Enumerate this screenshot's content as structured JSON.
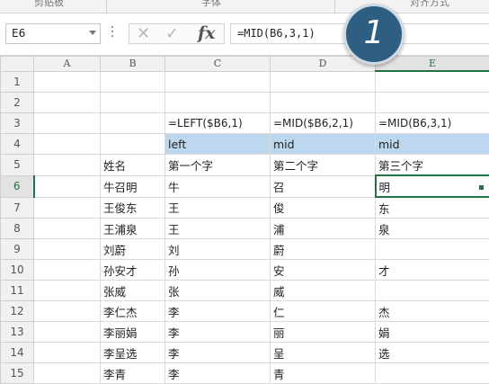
{
  "ribbon": {
    "labels": [
      "剪贴板",
      "字体",
      "对齐方式"
    ]
  },
  "formula_bar": {
    "name_box": "E6",
    "cancel_symbol": "✕",
    "enter_symbol": "✓",
    "fx_symbol": "fx",
    "formula": "=MID(B6,3,1)"
  },
  "step_badge": "1",
  "columns": [
    "A",
    "B",
    "C",
    "D",
    "E"
  ],
  "active_column": "E",
  "active_row": "6",
  "rows": [
    {
      "num": "1",
      "cells": [
        "",
        "",
        "",
        "",
        ""
      ]
    },
    {
      "num": "2",
      "cells": [
        "",
        "",
        "",
        "",
        ""
      ]
    },
    {
      "num": "3",
      "cells": [
        "",
        "",
        "=LEFT($B6,1)",
        "=MID($B6,2,1)",
        "=MID(B6,3,1)"
      ]
    },
    {
      "num": "4",
      "cells": [
        "",
        "",
        "left",
        "mid",
        "mid"
      ]
    },
    {
      "num": "5",
      "cells": [
        "",
        "姓名",
        "第一个字",
        "第二个字",
        "第三个字"
      ]
    },
    {
      "num": "6",
      "cells": [
        "",
        "牛召明",
        "牛",
        "召",
        "明"
      ]
    },
    {
      "num": "7",
      "cells": [
        "",
        "王俊东",
        "王",
        "俊",
        "东"
      ]
    },
    {
      "num": "8",
      "cells": [
        "",
        "王浦泉",
        "王",
        "浦",
        "泉"
      ]
    },
    {
      "num": "9",
      "cells": [
        "",
        "刘蔚",
        "刘",
        "蔚",
        ""
      ]
    },
    {
      "num": "10",
      "cells": [
        "",
        "孙安才",
        "孙",
        "安",
        "才"
      ]
    },
    {
      "num": "11",
      "cells": [
        "",
        "张威",
        "张",
        "威",
        ""
      ]
    },
    {
      "num": "12",
      "cells": [
        "",
        "李仁杰",
        "李",
        "仁",
        "杰"
      ]
    },
    {
      "num": "13",
      "cells": [
        "",
        "李丽娟",
        "李",
        "丽",
        "娟"
      ]
    },
    {
      "num": "14",
      "cells": [
        "",
        "李呈选",
        "李",
        "呈",
        "选"
      ]
    },
    {
      "num": "15",
      "cells": [
        "",
        "李青",
        "李",
        "青",
        ""
      ]
    }
  ],
  "colors": {
    "header_fill": "#bdd7ee",
    "accent": "#217346",
    "badge": "#2e5f83"
  }
}
